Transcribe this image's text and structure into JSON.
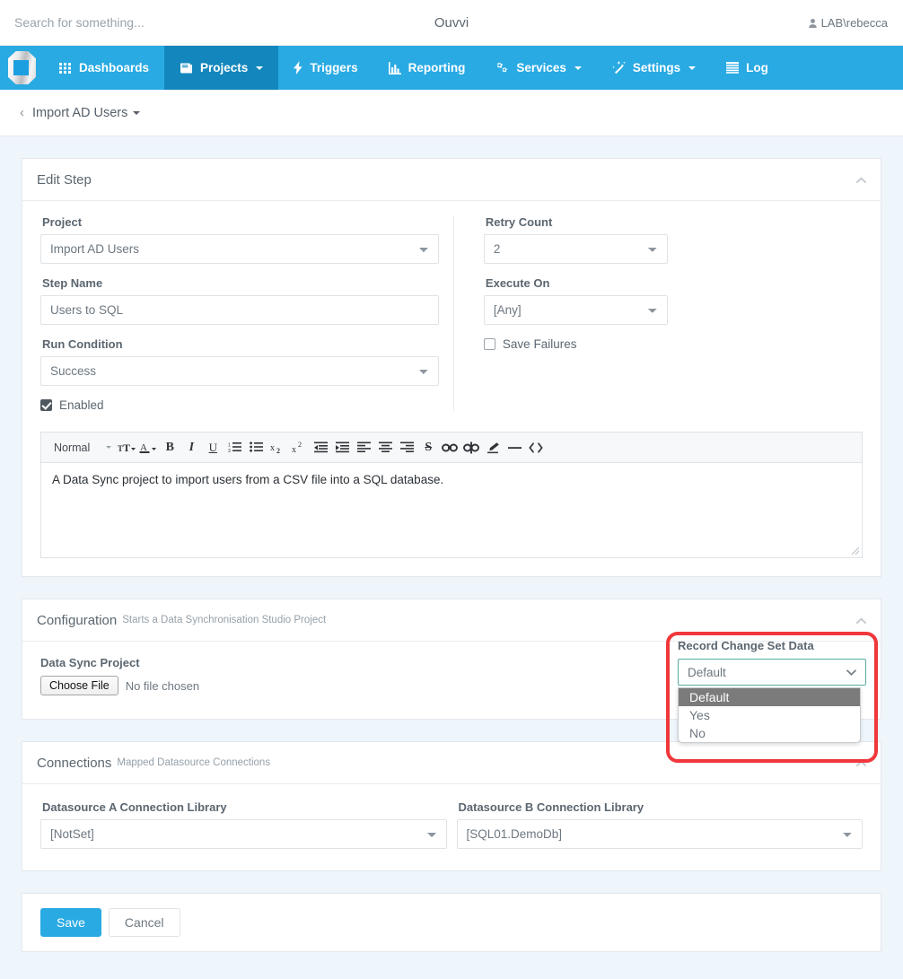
{
  "topbar": {
    "search_placeholder": "Search for something...",
    "search_value": "",
    "brand": "Ouvvi",
    "user": "LAB\\rebecca"
  },
  "nav": {
    "items": [
      {
        "label": "Dashboards",
        "icon": "grid-icon",
        "active": false,
        "caret": false
      },
      {
        "label": "Projects",
        "icon": "book-icon",
        "active": true,
        "caret": true
      },
      {
        "label": "Triggers",
        "icon": "bolt-icon",
        "active": false,
        "caret": false
      },
      {
        "label": "Reporting",
        "icon": "bar-chart-icon",
        "active": false,
        "caret": false
      },
      {
        "label": "Services",
        "icon": "gears-icon",
        "active": false,
        "caret": true
      },
      {
        "label": "Settings",
        "icon": "magic-wand-icon",
        "active": false,
        "caret": true
      },
      {
        "label": "Log",
        "icon": "list-icon",
        "active": false,
        "caret": false
      }
    ]
  },
  "breadcrumb": {
    "back": "‹",
    "label": "Import AD Users"
  },
  "edit_step": {
    "title": "Edit Step",
    "project_label": "Project",
    "project_value": "Import AD Users",
    "project_options": [
      "Import AD Users"
    ],
    "step_name_label": "Step Name",
    "step_name_value": "Users to SQL",
    "run_condition_label": "Run Condition",
    "run_condition_value": "Success",
    "run_condition_options": [
      "Success"
    ],
    "enabled_label": "Enabled",
    "enabled_checked": true,
    "retry_count_label": "Retry Count",
    "retry_count_value": "2",
    "retry_count_options": [
      "2"
    ],
    "execute_on_label": "Execute On",
    "execute_on_value": "[Any]",
    "execute_on_options": [
      "[Any]"
    ],
    "save_failures_label": "Save Failures",
    "save_failures_checked": false
  },
  "editor": {
    "format_label": "Normal",
    "tools": [
      "font-size-icon",
      "font-color-icon",
      "bold-icon",
      "italic-icon",
      "underline-icon",
      "ordered-list-icon",
      "bullet-list-icon",
      "subscript-icon",
      "superscript-icon",
      "outdent-icon",
      "indent-icon",
      "align-left-icon",
      "align-center-icon",
      "align-right-icon",
      "strikethrough-icon",
      "link-icon",
      "unlink-icon",
      "highlight-icon",
      "horizontal-rule-icon",
      "code-icon"
    ],
    "body": "A Data Sync project to import users from a CSV file into a SQL database."
  },
  "configuration": {
    "title": "Configuration",
    "subtitle": "Starts a Data Synchronisation Studio Project",
    "data_sync_project_label": "Data Sync Project",
    "choose_file_button": "Choose File",
    "no_file_text": "No file chosen"
  },
  "record_change_set": {
    "label": "Record Change Set Data",
    "value": "Default",
    "options": [
      "Default",
      "Yes",
      "No"
    ],
    "selected_index": 0,
    "open": true,
    "highlight_color": "#f0373c",
    "focus_border_color": "#58ada4"
  },
  "connections": {
    "title": "Connections",
    "subtitle": "Mapped Datasource Connections",
    "datasource_a_label": "Datasource A Connection Library",
    "datasource_a_value": "[NotSet]",
    "datasource_a_options": [
      "[NotSet]"
    ],
    "datasource_b_label": "Datasource B Connection Library",
    "datasource_b_value": "[SQL01.DemoDb]",
    "datasource_b_options": [
      "[SQL01.DemoDb]"
    ]
  },
  "footer": {
    "save_label": "Save",
    "cancel_label": "Cancel"
  }
}
